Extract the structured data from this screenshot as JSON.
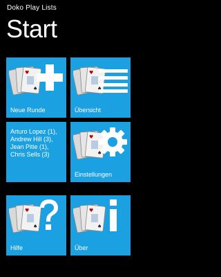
{
  "app": {
    "title": "Doko Play Lists"
  },
  "page": {
    "title": "Start"
  },
  "tiles": {
    "new_round": {
      "label": "Neue Runde",
      "icon": "plus-icon"
    },
    "overview": {
      "label": "Übersicht",
      "icon": "list-icon"
    },
    "players": {
      "lines": [
        "Arturo Lopez (1),",
        "Andrew Hill (3),",
        "Jean Pitie (1),",
        "Chris Sells (3)"
      ]
    },
    "settings": {
      "label": "Einstellungen",
      "icon": "gear-icon"
    },
    "help": {
      "label": "Hilfe",
      "icon": "question-icon"
    },
    "about": {
      "label": "Über",
      "icon": "info-icon"
    }
  },
  "colors": {
    "tile": "#1ba1e2",
    "background": "#000000",
    "foreground": "#ffffff"
  }
}
